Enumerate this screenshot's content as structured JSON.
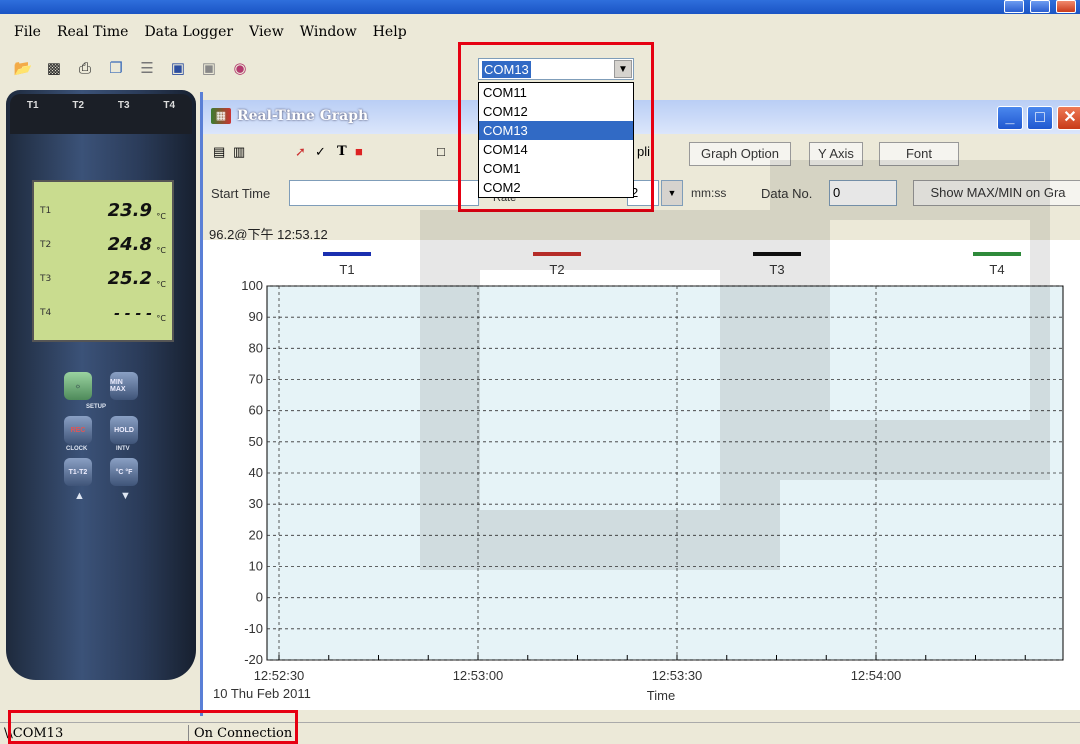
{
  "menu": [
    "File",
    "Real Time",
    "Data Logger",
    "View",
    "Window",
    "Help"
  ],
  "toolbar_icons": [
    "open-folder-icon",
    "save-icon",
    "print-icon",
    "copy-icon",
    "list-icon",
    "play-icon",
    "stop-icon",
    "book-icon"
  ],
  "com_select": {
    "selected": "COM13",
    "options": [
      "COM11",
      "COM12",
      "COM13",
      "COM14",
      "COM1",
      "COM2"
    ]
  },
  "device": {
    "channels": [
      "T1",
      "T2",
      "T3",
      "T4"
    ],
    "lcd_rows": [
      {
        "label": "T1",
        "value": "23.9",
        "unit": "°C"
      },
      {
        "label": "T2",
        "value": "24.8",
        "unit": "°C"
      },
      {
        "label": "T3",
        "value": "25.2",
        "unit": "°C"
      },
      {
        "label": "T4",
        "value": "- - - -",
        "unit": "°C"
      }
    ],
    "buttons": [
      "MIN MAX",
      "SETUP",
      "REC",
      "HOLD",
      "CLOCK",
      "INTV",
      "T1-T2",
      "°C °F"
    ]
  },
  "graph_window": {
    "title": "Real-Time Graph",
    "buttons": {
      "graph_option": "Graph Option",
      "y_axis": "Y Axis",
      "font": "Font"
    },
    "start_time_label": "Start Time",
    "rate_label": "Rate",
    "rate_value": "2",
    "rate_unit": "mm:ss",
    "data_no_label": "Data No.",
    "data_no_value": "0",
    "show_maxmin": "Show MAX/MIN on Gra",
    "readout": "96.2@下午 12:53.12"
  },
  "chart_data": {
    "type": "line",
    "series": [
      {
        "name": "T1",
        "color": "#1a2fb0",
        "values": []
      },
      {
        "name": "T2",
        "color": "#c8302c",
        "values": []
      },
      {
        "name": "T3",
        "color": "#111111",
        "values": []
      },
      {
        "name": "T4",
        "color": "#2e8a3a",
        "values": []
      }
    ],
    "x_ticks": [
      "12:52:30",
      "12:53:00",
      "12:53:30",
      "12:54:00"
    ],
    "x_date": "10 Thu Feb 2011",
    "xlabel": "Time",
    "y_ticks": [
      100,
      90,
      80,
      70,
      60,
      50,
      40,
      30,
      20,
      10,
      0,
      -10,
      -20
    ],
    "ylim": [
      -20,
      100
    ],
    "grid": true
  },
  "status": {
    "port": "\\\\COM13",
    "connection": "On Connection"
  }
}
